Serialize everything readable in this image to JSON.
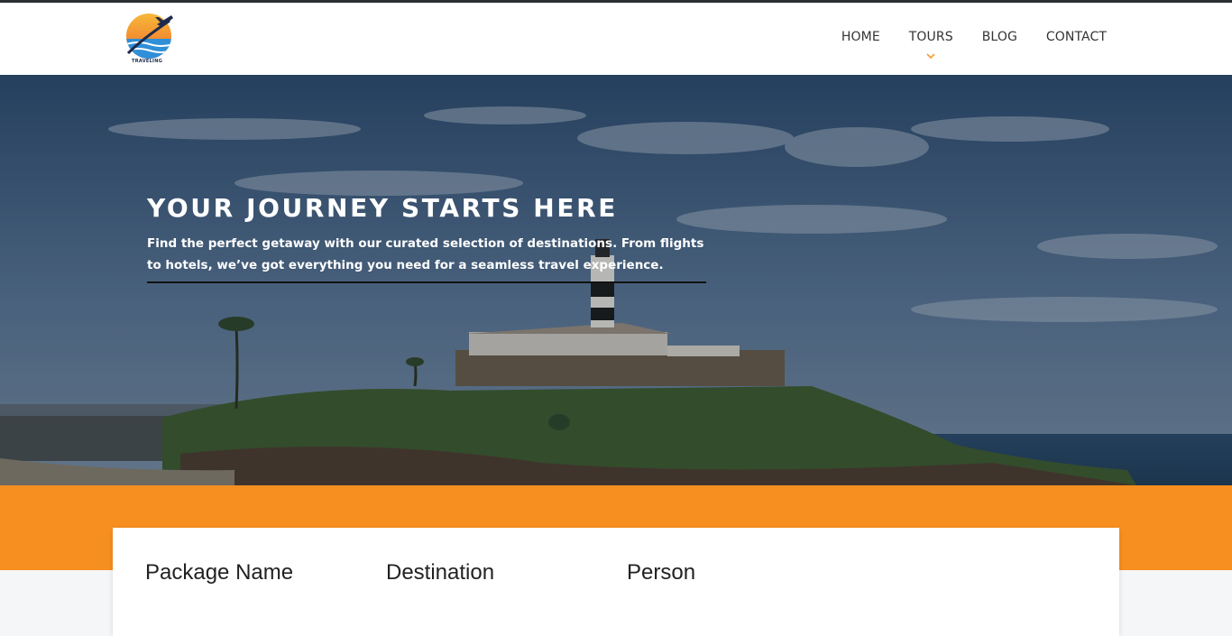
{
  "nav": {
    "logo_text": "TRAVELING",
    "items": [
      {
        "label": "HOME"
      },
      {
        "label": "TOURS",
        "has_dropdown": true
      },
      {
        "label": "BLOG"
      },
      {
        "label": "CONTACT"
      }
    ]
  },
  "hero": {
    "title": "YOUR JOURNEY STARTS HERE",
    "subtitle": "Find the perfect getaway with our curated selection of destinations. From flights to hotels, we’ve got everything you need for a seamless travel experience."
  },
  "search": {
    "fields": [
      {
        "label": "Package Name"
      },
      {
        "label": "Destination"
      },
      {
        "label": "Person"
      }
    ]
  },
  "colors": {
    "accent": "#f78f20",
    "header_bg": "#ffffff",
    "text_dark": "#333333"
  },
  "icons": [
    "logo-plane-sun",
    "chevron-down-icon"
  ]
}
